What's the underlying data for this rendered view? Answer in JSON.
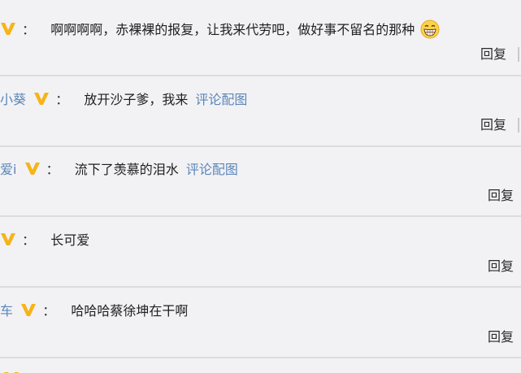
{
  "colors": {
    "background": "#f2f2f5",
    "divider": "#dcdce0",
    "username": "#5b86b8",
    "vip_badge": "#f6b418",
    "link": "#5b86b8"
  },
  "comments": [
    {
      "username": "",
      "colon": "：",
      "text": "啊啊啊啊，赤裸裸的报复，让我来代劳吧，做好事不留名的那种",
      "pic_link": "",
      "emoji": "grinning-face-emoji",
      "reply_label": "回复"
    },
    {
      "username": "小葵",
      "colon": "：",
      "text": "放开沙子爹，我来",
      "pic_link": "评论配图",
      "emoji": "",
      "reply_label": "回复"
    },
    {
      "username": "爱i",
      "colon": "：",
      "text": "流下了羡慕的泪水",
      "pic_link": "评论配图",
      "emoji": "",
      "reply_label": "回复"
    },
    {
      "username": "",
      "colon": "：",
      "text": "长可爱",
      "pic_link": "",
      "emoji": "",
      "reply_label": "回复"
    },
    {
      "username": "车",
      "colon": "：",
      "text": "哈哈哈蔡徐坤在干啊",
      "pic_link": "",
      "emoji": "",
      "reply_label": "回复"
    }
  ]
}
